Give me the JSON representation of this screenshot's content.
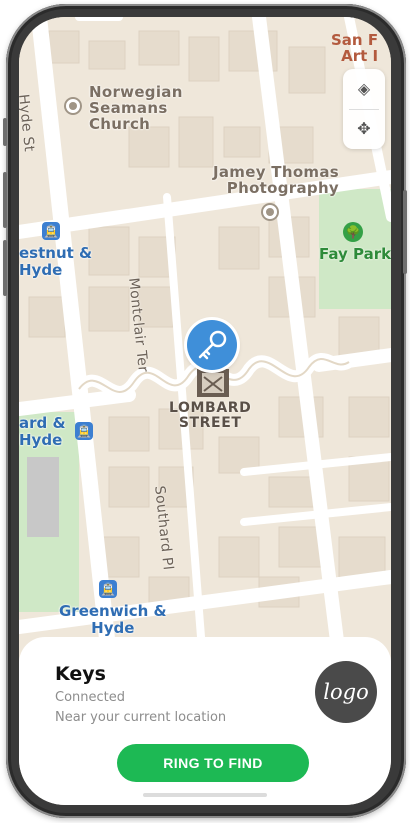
{
  "map": {
    "place_labels": {
      "norwegian_church": "Norwegian\nSeamans\nChurch",
      "photography": "Jamey Thomas\nPhotography",
      "san_francisco_art": "San F\nArt I"
    },
    "street_labels": {
      "hyde_st": "Hyde St",
      "montclair_terrace": "Montclair Ter",
      "southard_place": "Southard Pl"
    },
    "transit_stops": {
      "chestnut_hyde": "estnut &\nHyde",
      "lombard_hyde": "ard &\nHyde",
      "greenwich_hyde": "Greenwich &\nHyde"
    },
    "park_label": "Fay Park",
    "landmark_label": "LOMBARD\nSTREET",
    "colors": {
      "land": "#efe7da",
      "park": "#cfe8c6",
      "transit": "#3c7fd1",
      "pin": "#3f8fd9"
    },
    "icons": {
      "transit": "🚊",
      "park": "🌳",
      "layers": "◈",
      "move": "✥",
      "key": "key-icon"
    }
  },
  "item": {
    "title": "Keys",
    "status": "Connected",
    "location": "Near your current location",
    "logo_text": "logo"
  },
  "actions": {
    "ring_label": "RING TO FIND",
    "ring_color": "#1db954"
  }
}
